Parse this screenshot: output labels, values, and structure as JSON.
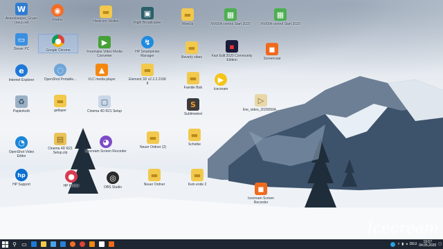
{
  "desktop_icons": {
    "aktenkoerper": "Aktenkoerper_Gruen\n(neu).odt",
    "dieser_pc": "Dieser PC",
    "internet_explorer": "Internet Explorer",
    "papierkorb": "Papierkorb",
    "openshot": "OpenShot Video\nEditor",
    "hp_support": "HP Support",
    "firefox": "Firefox",
    "google_chrome": "Google Chrome",
    "openshot_portable": "OpenShot Portable...",
    "getlayer": "getlayer",
    "cinema_setup": "Cinema 4D R21\nSetup.zip",
    "hp_printer": "HP Printer",
    "hardcore_welten": "Hardcore Welten",
    "freemake": "Freemake Video Media\nConverter",
    "vlc": "VLC media player",
    "cinema_4d_r21": "Cinema 4D R21 Setup",
    "icecream_screen": "Icecream Screen Recorder",
    "obs": "OBS Studio",
    "right_broadcaster": "Right Broadcaster",
    "hp_smart_manager": "HP Smartprinter\nManager",
    "element_3d": "Element 3D v2.2.2.2168\n8",
    "neuer_ordner_2": "Neuer Ordner (2)",
    "neuer_ordner": "Neuer Ordner",
    "wireup": "WireUp",
    "beverly_vibes": "Beverly vibes",
    "familie_bob": "Familie Bob",
    "sublimetext": "Sublimetext",
    "scheibe": "Scheibe",
    "kein_ende": "Kein ende 2",
    "nvidia_1": "NVIDIA control Start 2020",
    "fast_edit": "Fast Edit 2020 Community Edition",
    "icecream_2": "Icecream",
    "nvidia_2": "NVIDIA control Start 2020",
    "screencast": "Screencast",
    "line_video": "line_video_20200504...",
    "recorder_bottom": "Icecream Screen\nRecorder"
  },
  "taskbar": {
    "start_icon": "windows-start-icon",
    "language": "DEU",
    "time": "19:57",
    "date": "04.05.2020"
  },
  "watermark": {
    "brand": "Icecream",
    "sub": "APPS"
  },
  "colors": {
    "taskbar_bg": "#1d2631",
    "accent_blue": "#1e78d7"
  }
}
